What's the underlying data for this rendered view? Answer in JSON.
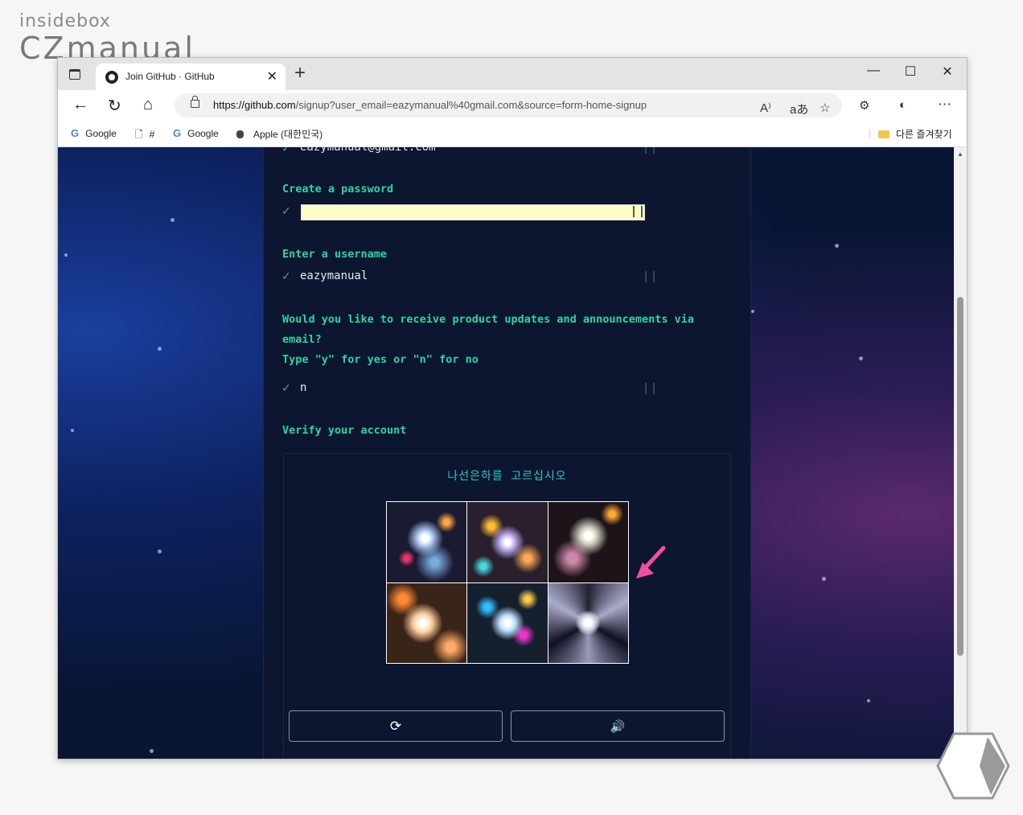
{
  "watermark": {
    "line1": "insidebox",
    "line2": "CZmanual"
  },
  "browser": {
    "tab_title": "Join GitHub · GitHub",
    "tab_close": "✕",
    "new_tab": "+",
    "window_controls": {
      "minimize": "—",
      "maximize": "☐",
      "close": "✕"
    },
    "nav": {
      "back": "←",
      "refresh": "↻",
      "home": "⌂"
    },
    "url": {
      "host": "https://github.com",
      "path": "/signup?user_email=eazymanual%40gmail.com&source=form-home-signup"
    },
    "toolbar_icons": {
      "read_aloud": "A⁾",
      "translate": "aあ",
      "favorites": "☆",
      "extensions": "⚙",
      "more": "⋯"
    },
    "bookmarks": [
      {
        "icon": "google-icon",
        "glyph": "G",
        "label": "Google"
      },
      {
        "icon": "page-icon",
        "glyph": "🗋",
        "label": "#"
      },
      {
        "icon": "google-icon",
        "glyph": "G",
        "label": "Google"
      },
      {
        "icon": "apple-icon",
        "glyph": "",
        "label": "Apple (대한민국)"
      }
    ],
    "other_favorites": "다른 즐겨찾기"
  },
  "signup": {
    "email_value": "eazymanual@gmail.com",
    "password_prompt": "Create a password",
    "username_prompt": "Enter a username",
    "username_value": "eazymanual",
    "updates_prompt_line1": "Would you like to receive product updates and announcements via",
    "updates_prompt_line2": "email?",
    "updates_prompt_line3": "Type \"y\" for yes or \"n\" for no",
    "updates_value": "n",
    "verify_prompt": "Verify your account",
    "check": "✓"
  },
  "captcha": {
    "instruction": "나선은하를 고르십시오",
    "images": [
      "galaxy-1",
      "galaxy-2",
      "galaxy-3",
      "galaxy-4",
      "galaxy-5",
      "spiral-galaxy"
    ],
    "refresh_icon": "⟳",
    "audio_icon": "🔊"
  }
}
